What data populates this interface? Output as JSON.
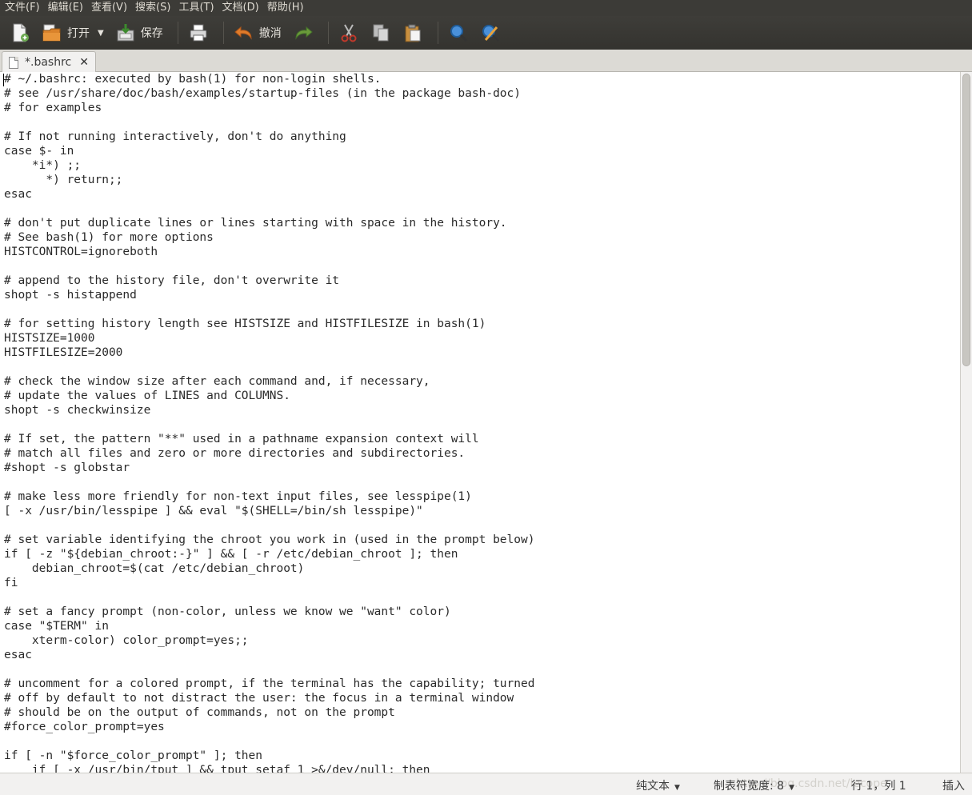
{
  "menubar": {
    "items": [
      "文件(F)",
      "编辑(E)",
      "查看(V)",
      "搜索(S)",
      "工具(T)",
      "文档(D)",
      "帮助(H)"
    ]
  },
  "toolbar": {
    "open_label": "打开",
    "save_label": "保存",
    "undo_label": "撤消"
  },
  "tab": {
    "title": "*.bashrc",
    "close": "✕"
  },
  "editor": {
    "lines": [
      "# ~/.bashrc: executed by bash(1) for non-login shells.",
      "# see /usr/share/doc/bash/examples/startup-files (in the package bash-doc)",
      "# for examples",
      "",
      "# If not running interactively, don't do anything",
      "case $- in",
      "    *i*) ;;",
      "      *) return;;",
      "esac",
      "",
      "# don't put duplicate lines or lines starting with space in the history.",
      "# See bash(1) for more options",
      "HISTCONTROL=ignoreboth",
      "",
      "# append to the history file, don't overwrite it",
      "shopt -s histappend",
      "",
      "# for setting history length see HISTSIZE and HISTFILESIZE in bash(1)",
      "HISTSIZE=1000",
      "HISTFILESIZE=2000",
      "",
      "# check the window size after each command and, if necessary,",
      "# update the values of LINES and COLUMNS.",
      "shopt -s checkwinsize",
      "",
      "# If set, the pattern \"**\" used in a pathname expansion context will",
      "# match all files and zero or more directories and subdirectories.",
      "#shopt -s globstar",
      "",
      "# make less more friendly for non-text input files, see lesspipe(1)",
      "[ -x /usr/bin/lesspipe ] && eval \"$(SHELL=/bin/sh lesspipe)\"",
      "",
      "# set variable identifying the chroot you work in (used in the prompt below)",
      "if [ -z \"${debian_chroot:-}\" ] && [ -r /etc/debian_chroot ]; then",
      "    debian_chroot=$(cat /etc/debian_chroot)",
      "fi",
      "",
      "# set a fancy prompt (non-color, unless we know we \"want\" color)",
      "case \"$TERM\" in",
      "    xterm-color) color_prompt=yes;;",
      "esac",
      "",
      "# uncomment for a colored prompt, if the terminal has the capability; turned",
      "# off by default to not distract the user: the focus in a terminal window",
      "# should be on the output of commands, not on the prompt",
      "#force_color_prompt=yes",
      "",
      "if [ -n \"$force_color_prompt\" ]; then",
      "    if [ -x /usr/bin/tput ] && tput setaf 1 >&/dev/null; then"
    ]
  },
  "statusbar": {
    "syntax": "纯文本",
    "tab_width": "制表符宽度: 8",
    "position": "行 1，列 1",
    "mode": "插入",
    "watermark": "http://blog.csdn.net/lecope"
  },
  "colors": {
    "menubar_bg": "#3c3b37",
    "toolbar_bg": "#3a3935",
    "editor_bg": "#ffffff",
    "undo_arrow": "#e07b2a",
    "redo_arrow": "#6a9a3a"
  }
}
